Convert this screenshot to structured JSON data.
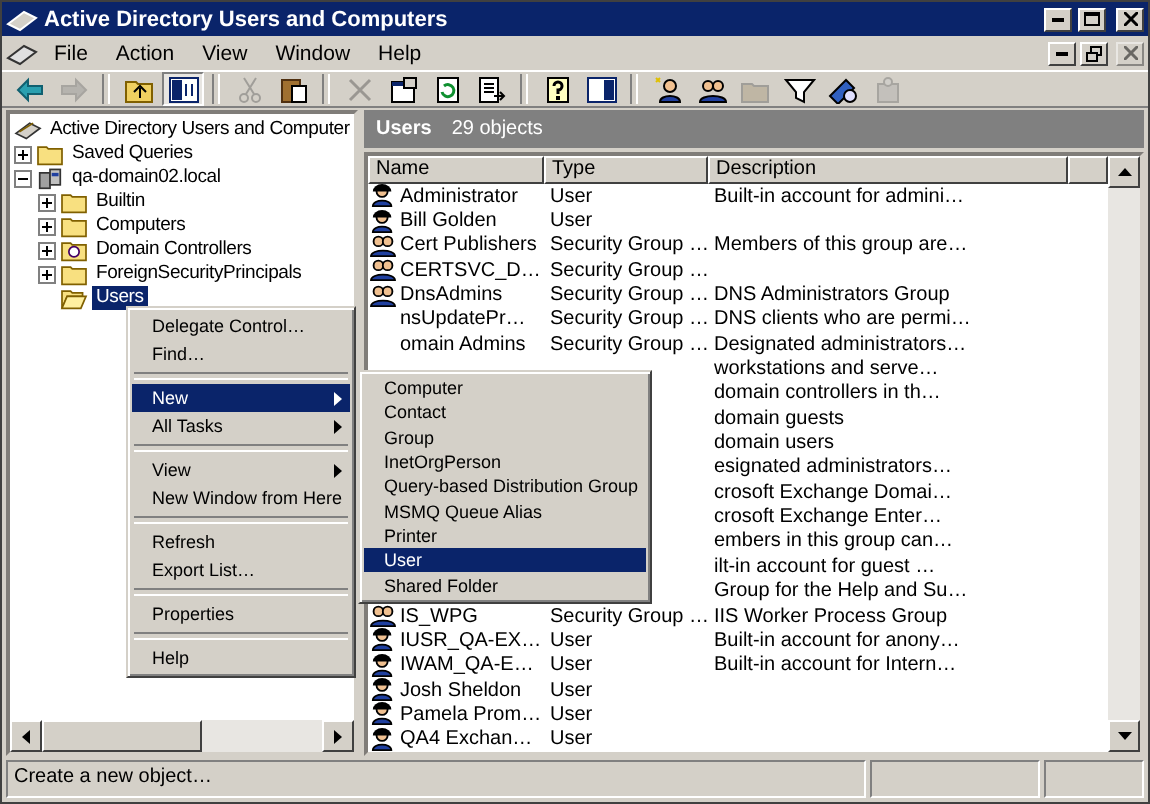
{
  "window": {
    "title": "Active Directory Users and Computers"
  },
  "menu_bar": [
    "File",
    "Action",
    "View",
    "Window",
    "Help"
  ],
  "toolbar": [
    {
      "kind": "back",
      "disabled": false
    },
    {
      "kind": "forward",
      "disabled": true
    },
    {
      "kind": "separator"
    },
    {
      "kind": "up",
      "disabled": false
    },
    {
      "kind": "tree",
      "disabled": false,
      "pressed": true
    },
    {
      "kind": "separator"
    },
    {
      "kind": "cut",
      "disabled": true
    },
    {
      "kind": "paste",
      "disabled": false
    },
    {
      "kind": "separator"
    },
    {
      "kind": "delete",
      "disabled": true
    },
    {
      "kind": "properties",
      "disabled": false
    },
    {
      "kind": "refresh",
      "disabled": false
    },
    {
      "kind": "export",
      "disabled": false
    },
    {
      "kind": "separator"
    },
    {
      "kind": "help",
      "disabled": false
    },
    {
      "kind": "pane",
      "disabled": false
    },
    {
      "kind": "separator"
    },
    {
      "kind": "new-user",
      "disabled": false
    },
    {
      "kind": "new-group",
      "disabled": false
    },
    {
      "kind": "new-ou",
      "disabled": true
    },
    {
      "kind": "filter",
      "disabled": false
    },
    {
      "kind": "find",
      "disabled": false
    },
    {
      "kind": "add-group",
      "disabled": true
    }
  ],
  "tree": {
    "items": [
      {
        "label": "Active Directory Users and Computer",
        "kind": "root",
        "selected": false,
        "children": [
          {
            "label": "Saved Queries",
            "kind": "folder",
            "expanded": false,
            "selected": false
          },
          {
            "label": "qa-domain02.local",
            "kind": "domain",
            "expanded": true,
            "selected": false,
            "children": [
              {
                "label": "Builtin",
                "kind": "folder",
                "expanded": false,
                "selected": false
              },
              {
                "label": "Computers",
                "kind": "folder",
                "expanded": false,
                "selected": false
              },
              {
                "label": "Domain Controllers",
                "kind": "ou",
                "expanded": false,
                "selected": false
              },
              {
                "label": "ForeignSecurityPrincipals",
                "kind": "folder",
                "expanded": false,
                "selected": false
              },
              {
                "label": "Users",
                "kind": "open-folder",
                "selected": true
              }
            ]
          }
        ]
      }
    ]
  },
  "pane": {
    "title": "Users",
    "count": "29 objects",
    "columns": [
      "Name",
      "Type",
      "Description"
    ],
    "rows": [
      {
        "kind": "user",
        "name": "Administrator",
        "type": "User",
        "description": "Built-in account for admini…"
      },
      {
        "kind": "user",
        "name": "Bill Golden",
        "type": "User"
      },
      {
        "kind": "group",
        "name": "Cert Publishers",
        "type": "Security Group …",
        "description": "Members of this group are…"
      },
      {
        "kind": "group",
        "name": "CERTSVC_D…",
        "type": "Security Group …"
      },
      {
        "kind": "group",
        "name": "DnsAdmins",
        "type": "Security Group …",
        "description": "DNS Administrators Group"
      },
      {
        "name": "nsUpdatePr…",
        "type": "Security Group …",
        "description": "DNS clients who are permi…"
      },
      {
        "name": "omain Admins",
        "type": "Security Group …",
        "description": "Designated administrators…"
      },
      {
        "description": "workstations and serve…"
      },
      {
        "description": "domain controllers in th…"
      },
      {
        "description": "domain guests"
      },
      {
        "description": "domain users"
      },
      {
        "description": "esignated administrators…"
      },
      {
        "description": "crosoft Exchange Domai…"
      },
      {
        "description": "crosoft Exchange Enter…"
      },
      {
        "description": "embers in this group can…"
      },
      {
        "description": "ilt-in account for guest …"
      },
      {
        "description": "Group for the Help and Su…"
      },
      {
        "kind": "group",
        "name": "IS_WPG",
        "type": "Security Group …",
        "description": "IIS Worker Process Group"
      },
      {
        "kind": "user",
        "name": "IUSR_QA-EX…",
        "type": "User",
        "description": "Built-in account for anony…"
      },
      {
        "kind": "user",
        "name": "IWAM_QA-E…",
        "type": "User",
        "description": "Built-in account for Intern…"
      },
      {
        "kind": "user",
        "name": "Josh Sheldon",
        "type": "User"
      },
      {
        "kind": "user",
        "name": "Pamela Prom…",
        "type": "User"
      },
      {
        "kind": "user",
        "name": "QA4 Exchan…",
        "type": "User"
      }
    ]
  },
  "context_menu": {
    "items": [
      {
        "label": "Delegate Control…",
        "kind": "item",
        "selected": false
      },
      {
        "label": "Find…",
        "kind": "item",
        "selected": false
      },
      {
        "kind": "separator"
      },
      {
        "label": "New",
        "kind": "submenu",
        "selected": true
      },
      {
        "label": "All Tasks",
        "kind": "submenu",
        "selected": false
      },
      {
        "kind": "separator"
      },
      {
        "label": "View",
        "kind": "submenu",
        "selected": false
      },
      {
        "label": "New Window from Here",
        "kind": "item",
        "selected": false
      },
      {
        "kind": "separator"
      },
      {
        "label": "Refresh",
        "kind": "item",
        "selected": false
      },
      {
        "label": "Export List…",
        "kind": "item",
        "selected": false
      },
      {
        "kind": "separator"
      },
      {
        "label": "Properties",
        "kind": "item",
        "selected": false
      },
      {
        "kind": "separator"
      },
      {
        "label": "Help",
        "kind": "item",
        "selected": false
      }
    ]
  },
  "submenu": {
    "items": [
      {
        "label": "Computer",
        "selected": false
      },
      {
        "label": "Contact",
        "selected": false
      },
      {
        "label": "Group",
        "selected": false
      },
      {
        "label": "InetOrgPerson",
        "selected": false
      },
      {
        "label": "Query-based Distribution Group",
        "selected": false
      },
      {
        "label": "MSMQ Queue Alias",
        "selected": false
      },
      {
        "label": "Printer",
        "selected": false
      },
      {
        "label": "User",
        "selected": true
      },
      {
        "label": "Shared Folder",
        "selected": false
      }
    ]
  },
  "status_bar": {
    "text": "Create a new object…"
  }
}
